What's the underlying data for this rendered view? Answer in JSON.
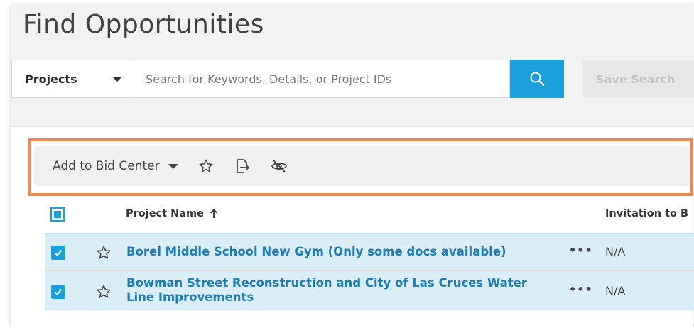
{
  "page": {
    "title": "Find Opportunities"
  },
  "search": {
    "type_selected": "Projects",
    "placeholder": "Search for Keywords, Details, or Project IDs",
    "value": "",
    "save_label": "Save Search"
  },
  "toolbar": {
    "add_to_bid_center_label": "Add to Bid Center",
    "icons": [
      "caret-down-icon",
      "star-icon",
      "export-icon",
      "hide-icon"
    ]
  },
  "table": {
    "columns": [
      {
        "label": "Project Name",
        "sort": "ascending"
      },
      {
        "label": "Invitation to B"
      }
    ],
    "rows": [
      {
        "checked": true,
        "name": "Borel Middle School New Gym (Only some docs available)",
        "actions": "•••",
        "invitation": "N/A"
      },
      {
        "checked": true,
        "name": "Bowman Street Reconstruction and City of Las Cruces Water Line Improvements",
        "actions": "•••",
        "invitation": "N/A"
      }
    ]
  },
  "colors": {
    "accent": "#1aa1dc",
    "link": "#1b7db4",
    "selected_row": "#daeef8",
    "highlight_border": "#f0894c"
  }
}
